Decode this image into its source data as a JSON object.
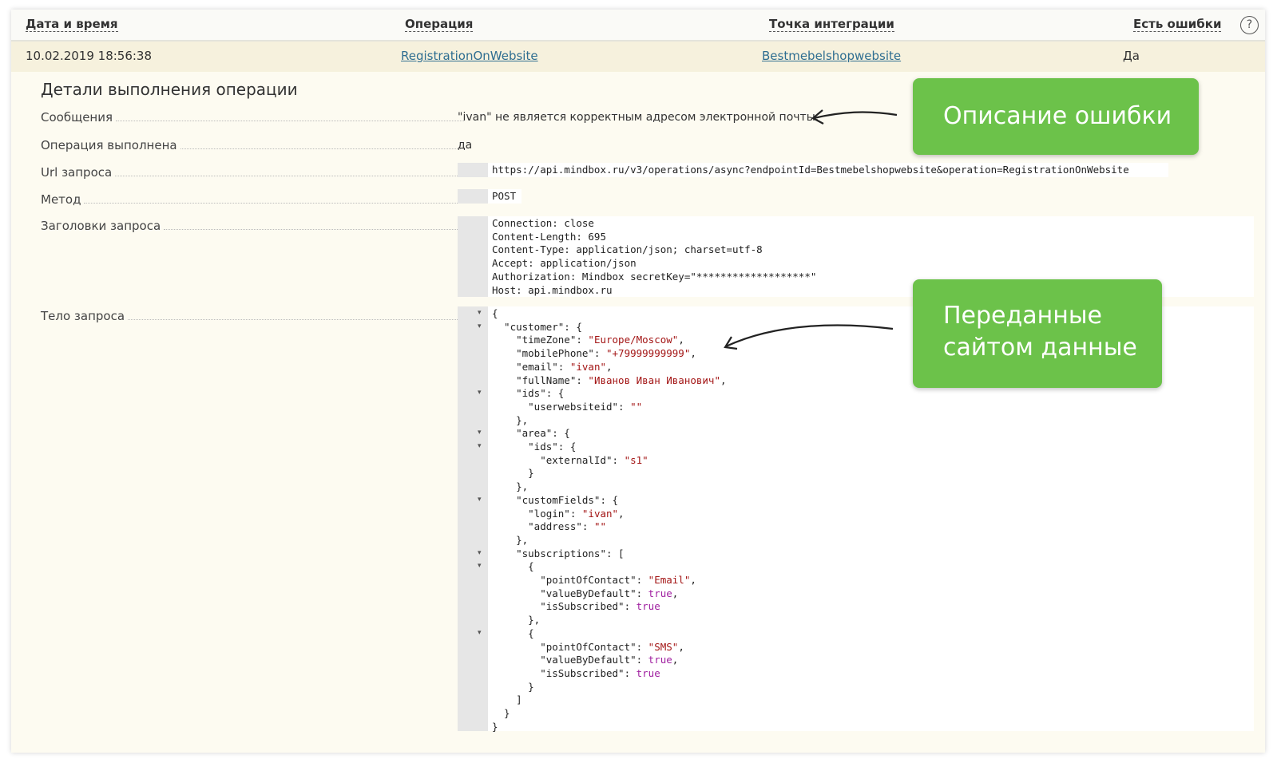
{
  "table": {
    "headers": {
      "datetime": "Дата и время",
      "operation": "Операция",
      "integration_point": "Точка интеграции",
      "has_errors": "Есть ошибки"
    },
    "help_icon": "question-icon",
    "row": {
      "datetime": "10.02.2019 18:56:38",
      "operation": "RegistrationOnWebsite",
      "integration_point": "Bestmebelshopwebsite",
      "has_errors": "Да"
    }
  },
  "details": {
    "title": "Детали выполнения операции",
    "messages_label": "Сообщения",
    "messages_value": "\"ivan\" не является корректным адресом электронной почты.",
    "completed_label": "Операция выполнена",
    "completed_value": "да",
    "url_label": "Url запроса",
    "url_value": "https://api.mindbox.ru/v3/operations/async?endpointId=Bestmebelshopwebsite&operation=RegistrationOnWebsite",
    "method_label": "Метод",
    "method_value": "POST",
    "headers_label": "Заголовки запроса",
    "headers_lines": [
      "Connection: close",
      "Content-Length: 695",
      "Content-Type: application/json; charset=utf-8",
      "Accept: application/json",
      "Authorization: Mindbox secretKey=\"*******************\"",
      "Host: api.mindbox.ru"
    ],
    "body_label": "Тело запроса",
    "body_lines": [
      "{",
      "  \"customer\": {",
      "    \"timeZone\": \"Europe/Moscow\",",
      "    \"mobilePhone\": \"+79999999999\",",
      "    \"email\": \"ivan\",",
      "    \"fullName\": \"Иванов Иван Иванович\",",
      "    \"ids\": {",
      "      \"userwebsiteid\": \"\"",
      "    },",
      "    \"area\": {",
      "      \"ids\": {",
      "        \"externalId\": \"s1\"",
      "      }",
      "    },",
      "    \"customFields\": {",
      "      \"login\": \"ivan\",",
      "      \"address\": \"\"",
      "    },",
      "    \"subscriptions\": [",
      "      {",
      "        \"pointOfContact\": \"Email\",",
      "        \"valueByDefault\": true,",
      "        \"isSubscribed\": true",
      "      },",
      "      {",
      "        \"pointOfContact\": \"SMS\",",
      "        \"valueByDefault\": true,",
      "        \"isSubscribed\": true",
      "      }",
      "    ]",
      "  }",
      "}"
    ],
    "fold_lines": [
      0,
      1,
      6,
      9,
      10,
      14,
      18,
      19,
      24
    ]
  },
  "callouts": {
    "error_description": "Описание ошибки",
    "site_data_line1": "Переданные",
    "site_data_line2": "сайтом данные"
  },
  "colors": {
    "callout_green": "#6cc24a",
    "link_blue": "#2f6e91",
    "string_red": "#a31515",
    "bool_purple": "#a020a0"
  }
}
